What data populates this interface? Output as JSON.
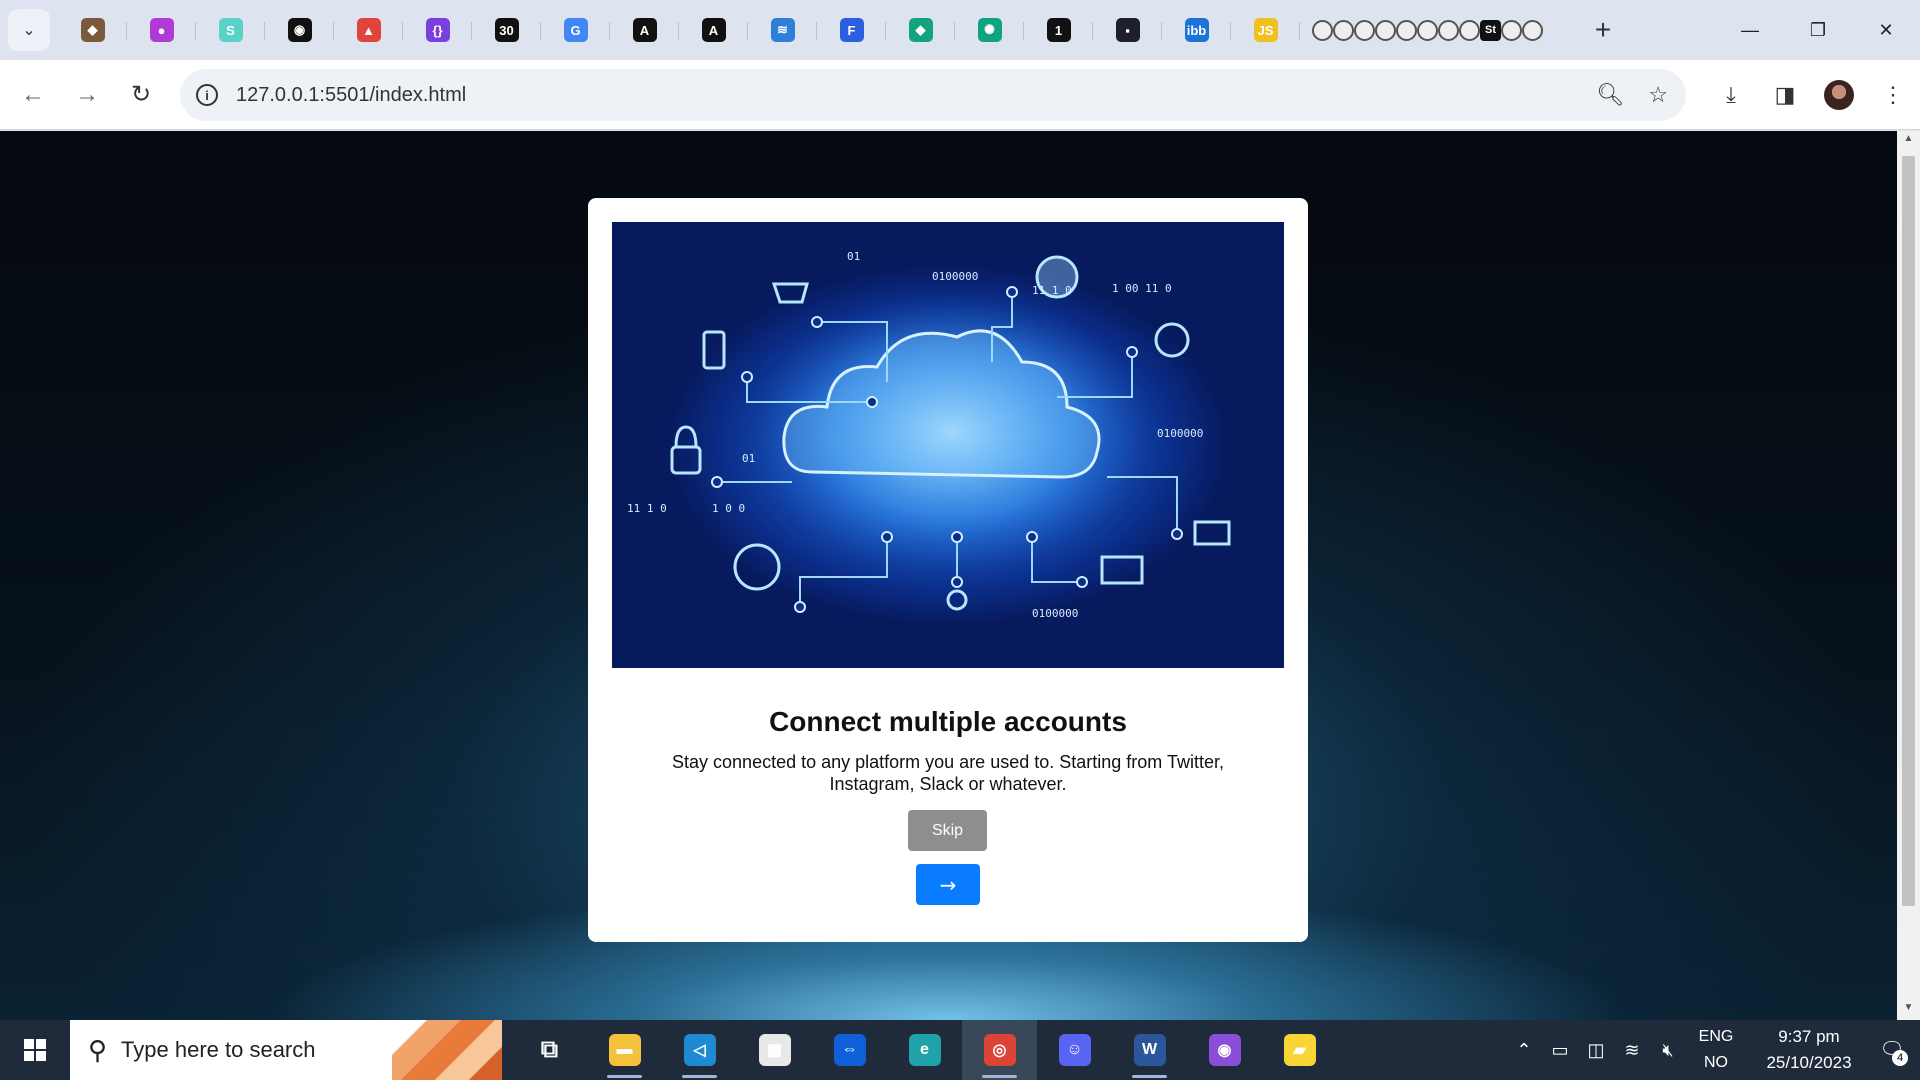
{
  "browser": {
    "tab_search_icon": "chevron-down-icon",
    "pinned_tabs": [
      {
        "name": "tab-1",
        "color": "#7a5a3a",
        "glyph": "◆"
      },
      {
        "name": "tab-2",
        "color": "#b03ad6",
        "glyph": "●"
      },
      {
        "name": "tab-3",
        "color": "#59d3c8",
        "glyph": "S"
      },
      {
        "name": "tab-github",
        "color": "#111111",
        "glyph": "◉"
      },
      {
        "name": "tab-5",
        "color": "#e0443a",
        "glyph": "▲"
      },
      {
        "name": "tab-6",
        "color": "#7b3fe0",
        "glyph": "{}"
      },
      {
        "name": "tab-7",
        "color": "#111111",
        "glyph": "30"
      },
      {
        "name": "tab-google",
        "color": "#4285f4",
        "glyph": "G"
      },
      {
        "name": "tab-9",
        "color": "#111111",
        "glyph": "A"
      },
      {
        "name": "tab-10",
        "color": "#111111",
        "glyph": "A"
      },
      {
        "name": "tab-11",
        "color": "#2f7ed8",
        "glyph": "≋"
      },
      {
        "name": "tab-12",
        "color": "#2c5fe0",
        "glyph": "F"
      },
      {
        "name": "tab-13",
        "color": "#14a37f",
        "glyph": "◆"
      },
      {
        "name": "tab-chatgpt",
        "color": "#10a37f",
        "glyph": "✺"
      },
      {
        "name": "tab-15",
        "color": "#111111",
        "glyph": "1"
      },
      {
        "name": "tab-16",
        "color": "#1e1e2e",
        "glyph": "▪"
      },
      {
        "name": "tab-ibb",
        "color": "#1c74d8",
        "glyph": "ibb"
      },
      {
        "name": "tab-js",
        "color": "#f0c020",
        "glyph": "JS"
      }
    ],
    "mini_tab_count": 11,
    "mini_dark_label": "St",
    "new_tab_label": "+",
    "url": "127.0.0.1:5501/index.html"
  },
  "card": {
    "title": "Connect multiple accounts",
    "text": "Stay connected to any platform you are used to. Starting from Twitter, Instagram, Slack or whatever.",
    "skip_label": "Skip",
    "next_label": "→"
  },
  "hero": {
    "binary": [
      "01",
      "0100000",
      "11 1 0",
      "1 00 11 0",
      "0100000",
      "01",
      "11 1 0",
      "1 0 0",
      "0100000"
    ]
  },
  "taskbar": {
    "search_placeholder": "Type here to search",
    "apps": [
      {
        "name": "task-view-icon",
        "color": "transparent",
        "glyph": "⧉",
        "running": false
      },
      {
        "name": "file-explorer-icon",
        "color": "#f3c13a",
        "glyph": "▬",
        "running": true
      },
      {
        "name": "vscode-icon",
        "color": "#1f8ad2",
        "glyph": "◁",
        "running": true
      },
      {
        "name": "ms-store-icon",
        "color": "#e8e8e8",
        "glyph": "▦",
        "running": false
      },
      {
        "name": "teamviewer-icon",
        "color": "#0e5fd8",
        "glyph": "⇔",
        "running": false
      },
      {
        "name": "edge-icon",
        "color": "#1fa3a8",
        "glyph": "e",
        "running": false
      },
      {
        "name": "chrome-icon",
        "color": "#db4437",
        "glyph": "◎",
        "running": true,
        "active": true
      },
      {
        "name": "discord-icon",
        "color": "#5865f2",
        "glyph": "☺",
        "running": false
      },
      {
        "name": "word-icon",
        "color": "#2b579a",
        "glyph": "W",
        "running": true
      },
      {
        "name": "github-desktop-icon",
        "color": "#8a4fd8",
        "glyph": "◉",
        "running": false
      },
      {
        "name": "sticky-notes-icon",
        "color": "#f8d534",
        "glyph": "▰",
        "running": false
      }
    ],
    "lang_top": "ENG",
    "lang_bottom": "NO",
    "time": "9:37 pm",
    "date": "25/10/2023",
    "notif_count": "4"
  }
}
